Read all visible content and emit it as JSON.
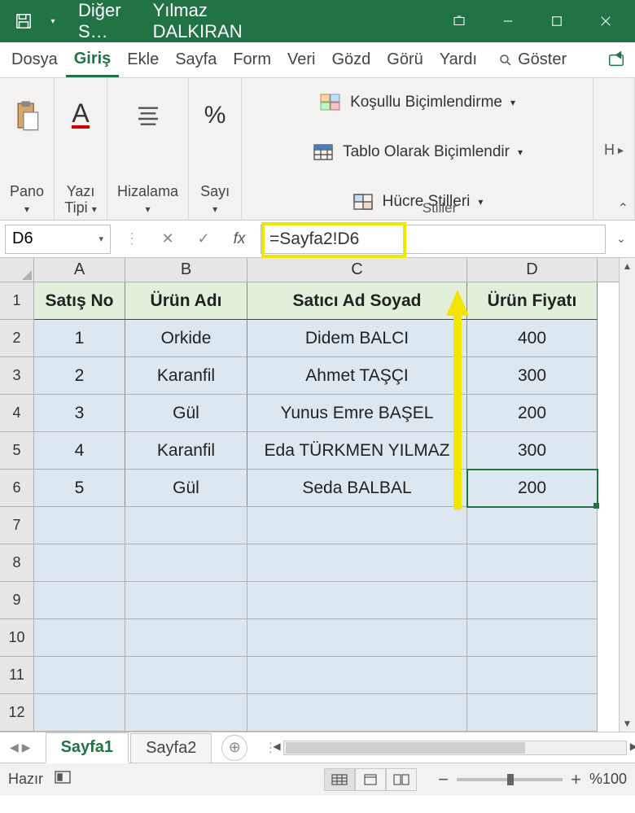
{
  "titlebar": {
    "filename": "Diğer S…",
    "user": "Yılmaz DALKIRAN"
  },
  "ribbon_tabs": [
    "Dosya",
    "Giriş",
    "Ekle",
    "Sayfa",
    "Form",
    "Veri",
    "Gözd",
    "Görü",
    "Yardı"
  ],
  "ribbon_active": "Giriş",
  "ribbon_goster": "Göster",
  "ribbon": {
    "pano": "Pano",
    "yazi_tipi": "Yazı\nTipi",
    "hizalama": "Hizalama",
    "sayi": "Sayı",
    "styles_label": "Stiller",
    "style_items": [
      "Koşullu Biçimlendirme",
      "Tablo Olarak Biçimlendir",
      "Hücre Stilleri"
    ],
    "h_group": "H"
  },
  "namebox": "D6",
  "formula": "=Sayfa2!D6",
  "columns": [
    "A",
    "B",
    "C",
    "D"
  ],
  "row_numbers": [
    1,
    2,
    3,
    4,
    5,
    6,
    7,
    8,
    9,
    10,
    11,
    12
  ],
  "headers": [
    "Satış No",
    "Ürün Adı",
    "Satıcı Ad Soyad",
    "Ürün Fiyatı"
  ],
  "rows": [
    [
      "1",
      "Orkide",
      "Didem BALCI",
      "400"
    ],
    [
      "2",
      "Karanfil",
      "Ahmet TAŞÇI",
      "300"
    ],
    [
      "3",
      "Gül",
      "Yunus Emre BAŞEL",
      "200"
    ],
    [
      "4",
      "Karanfil",
      "Eda TÜRKMEN YILMAZ",
      "300"
    ],
    [
      "5",
      "Gül",
      "Seda BALBAL",
      "200"
    ]
  ],
  "selected_cell": "D6",
  "sheets": [
    "Sayfa1",
    "Sayfa2"
  ],
  "active_sheet": "Sayfa1",
  "status": {
    "ready": "Hazır",
    "zoom": "%100"
  }
}
